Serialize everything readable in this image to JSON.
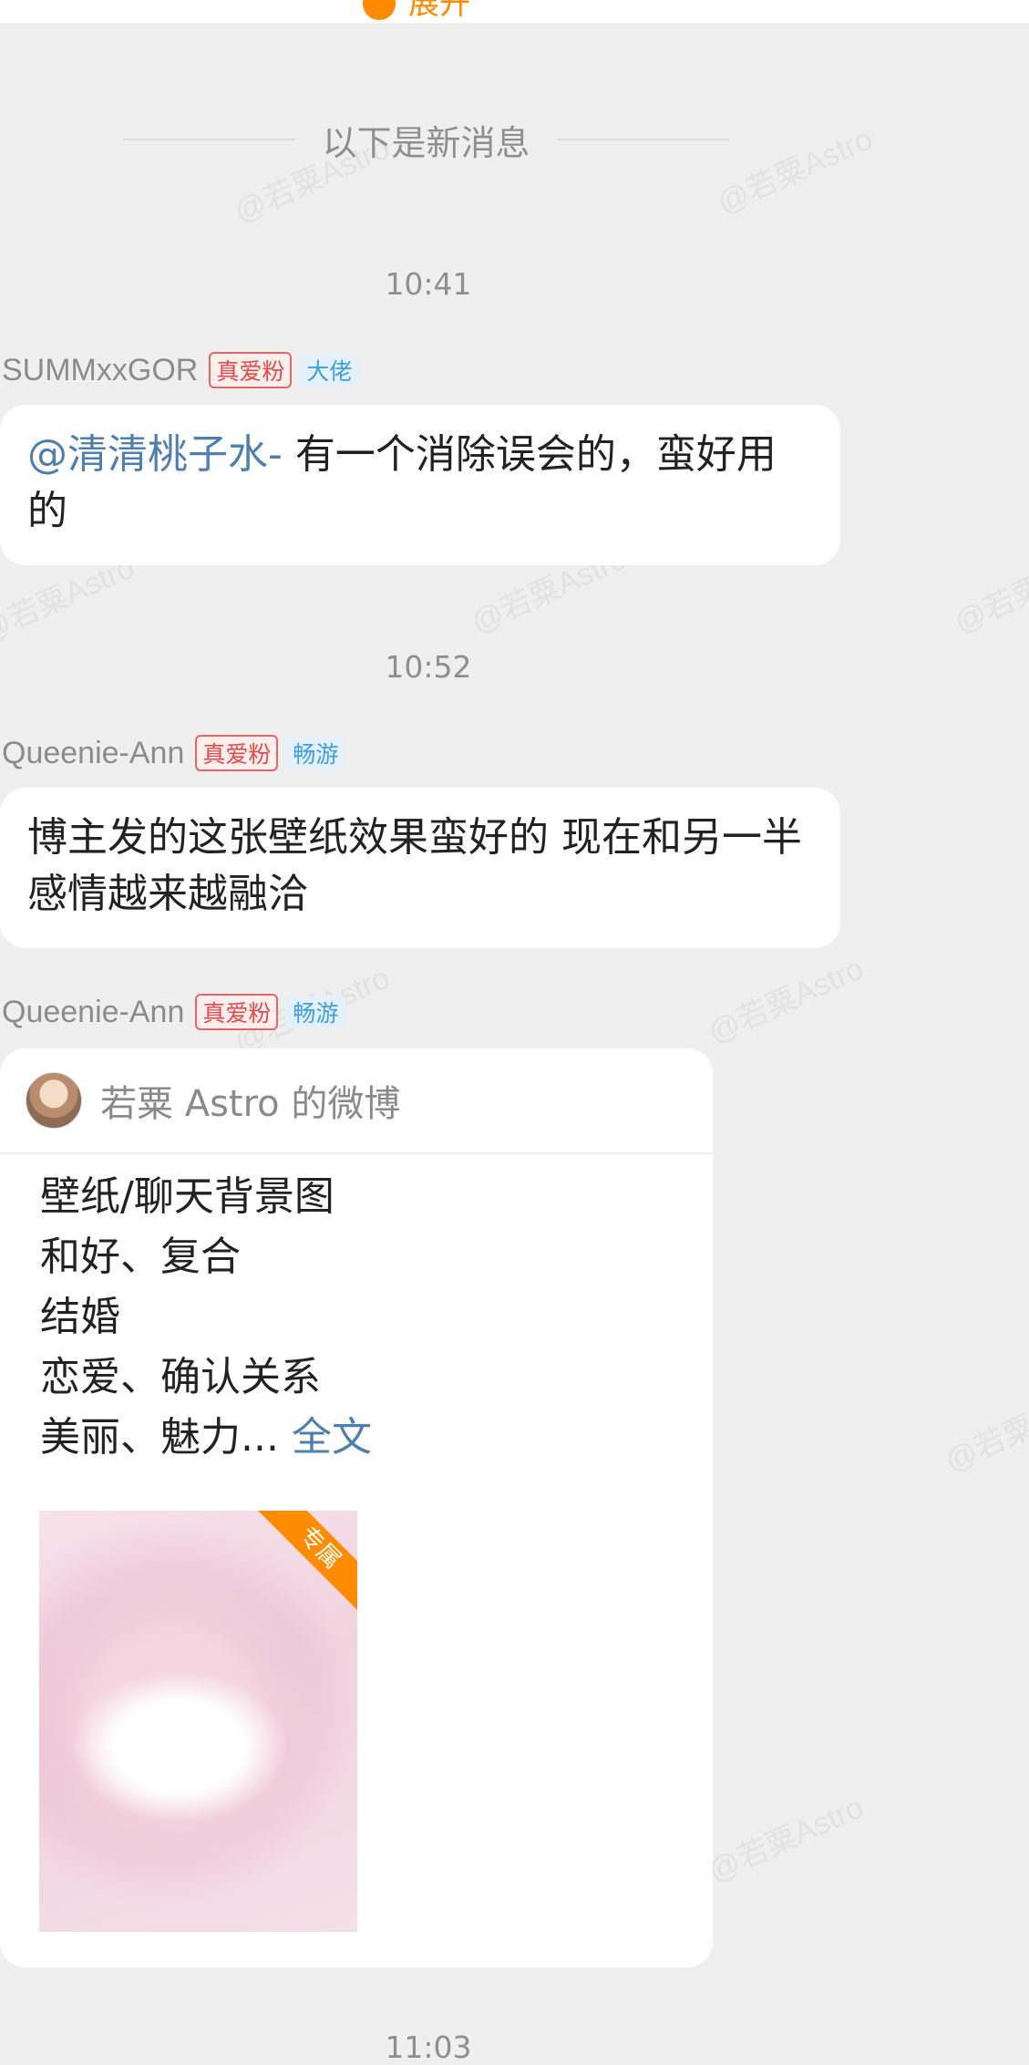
{
  "top_bar": {
    "expand_label": "展开"
  },
  "divider": {
    "new_messages": "以下是新消息"
  },
  "watermark": "@若粟Astro",
  "messages": [
    {
      "time": "10:41",
      "sender": "SUMMxxGOR",
      "fan_badge": "真爱粉",
      "level_badge": "大佬",
      "mention": "@清清桃子水-",
      "text": " 有一个消除误会的，蛮好用的"
    },
    {
      "time": "10:52",
      "sender": "Queenie-Ann",
      "fan_badge": "真爱粉",
      "level_badge": "畅游",
      "text": "博主发的这张壁纸效果蛮好的 现在和另一半感情越来越融洽"
    },
    {
      "sender": "Queenie-Ann",
      "fan_badge": "真爱粉",
      "level_badge": "畅游",
      "card": {
        "source": "若粟 Astro 的微博",
        "lines": [
          "壁纸/聊天背景图",
          "和好、复合",
          "结婚",
          "恋爱、确认关系",
          "美丽、魅力..."
        ],
        "fulltext_link": "全文",
        "image_tag": "专属"
      }
    }
  ],
  "next_time": "11:03"
}
